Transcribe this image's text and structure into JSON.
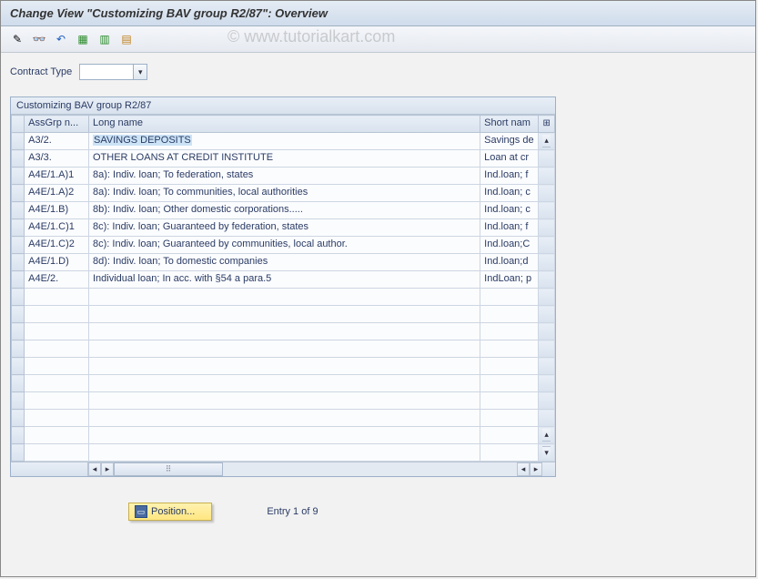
{
  "title": "Change View \"Customizing BAV group R2/87\": Overview",
  "watermark": "© www.tutorialkart.com",
  "toolbar": {
    "icons": [
      "edit-icon",
      "glasses-icon",
      "undo-icon",
      "save-icon",
      "save-new-icon",
      "save-all-icon"
    ]
  },
  "filter": {
    "label": "Contract Type",
    "value": ""
  },
  "panel": {
    "title": "Customizing BAV group R2/87",
    "columns": {
      "assgrp": "AssGrp n...",
      "long": "Long name",
      "short": "Short nam"
    },
    "rows": [
      {
        "assgrp": "A3/2.",
        "long": "SAVINGS DEPOSITS",
        "short": "Savings de",
        "highlight": true
      },
      {
        "assgrp": "A3/3.",
        "long": "OTHER LOANS AT CREDIT INSTITUTE",
        "short": "Loan at cr"
      },
      {
        "assgrp": "A4E/1.A)1",
        "long": "8a): Indiv. loan;    To federation, states",
        "short": "Ind.loan; f"
      },
      {
        "assgrp": "A4E/1.A)2",
        "long": "8a): Indiv. loan; To communities, local authorities",
        "short": "Ind.loan; c"
      },
      {
        "assgrp": "A4E/1.B)",
        "long": "8b): Indiv. loan; Other domestic corporations.....",
        "short": "Ind.loan; c"
      },
      {
        "assgrp": "A4E/1.C)1",
        "long": "8c): Indiv. loan; Guaranteed by federation, states",
        "short": "Ind.loan; f"
      },
      {
        "assgrp": "A4E/1.C)2",
        "long": "8c): Indiv. loan; Guaranteed by communities, local author.",
        "short": "Ind.loan;C"
      },
      {
        "assgrp": "A4E/1.D)",
        "long": "8d): Indiv. loan; To domestic companies",
        "short": "Ind.loan;d"
      },
      {
        "assgrp": "A4E/2.",
        "long": "     Individual loan; In acc. with §54 a para.5",
        "short": "IndLoan; p"
      }
    ],
    "empty_rows": 10
  },
  "footer": {
    "position_label": "Position...",
    "entry_info": "Entry 1 of 9"
  }
}
